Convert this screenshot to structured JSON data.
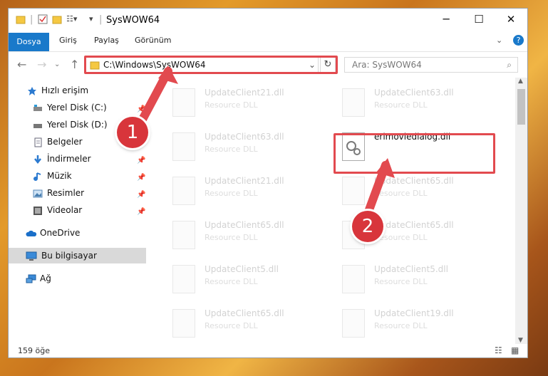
{
  "window": {
    "title": "SysWOW64"
  },
  "ribbon": {
    "tabs": [
      "Dosya",
      "Giriş",
      "Paylaş",
      "Görünüm"
    ]
  },
  "address": {
    "path": "C:\\Windows\\SysWOW64"
  },
  "search": {
    "placeholder": "Ara: SysWOW64"
  },
  "sidebar": {
    "items": [
      {
        "label": "Hızlı erişim"
      },
      {
        "label": "Yerel Disk (C:)"
      },
      {
        "label": "Yerel Disk (D:)"
      },
      {
        "label": "Belgeler"
      },
      {
        "label": "İndirmeler"
      },
      {
        "label": "Müzik"
      },
      {
        "label": "Resimler"
      },
      {
        "label": "Videolar"
      },
      {
        "label": "OneDrive"
      },
      {
        "label": "Bu bilgisayar"
      },
      {
        "label": "Ağ"
      }
    ]
  },
  "files": [
    {
      "name": "UpdateClient21.dll",
      "type": "Resource DLL"
    },
    {
      "name": "UpdateClient63.dll",
      "type": "Resource DLL"
    },
    {
      "name": "UpdateClient63.dll",
      "type": "Resource DLL"
    },
    {
      "name": "erimoviedialog.dll",
      "type": ""
    },
    {
      "name": "UpdateClient21.dll",
      "type": "Resource DLL"
    },
    {
      "name": "UpdateClient65.dll",
      "type": "Resource DLL"
    },
    {
      "name": "UpdateClient65.dll",
      "type": "Resource DLL"
    },
    {
      "name": "UpdateClient65.dll",
      "type": "Resource DLL"
    },
    {
      "name": "UpdateClient5.dll",
      "type": "Resource DLL"
    },
    {
      "name": "UpdateClient5.dll",
      "type": "Resource DLL"
    },
    {
      "name": "UpdateClient65.dll",
      "type": "Resource DLL"
    },
    {
      "name": "UpdateClient19.dll",
      "type": "Resource DLL"
    }
  ],
  "status": {
    "count": "159 öğe"
  },
  "annotations": {
    "step1": "1",
    "step2": "2"
  },
  "colors": {
    "accent": "#1979ca",
    "highlight": "#e24a4f"
  }
}
